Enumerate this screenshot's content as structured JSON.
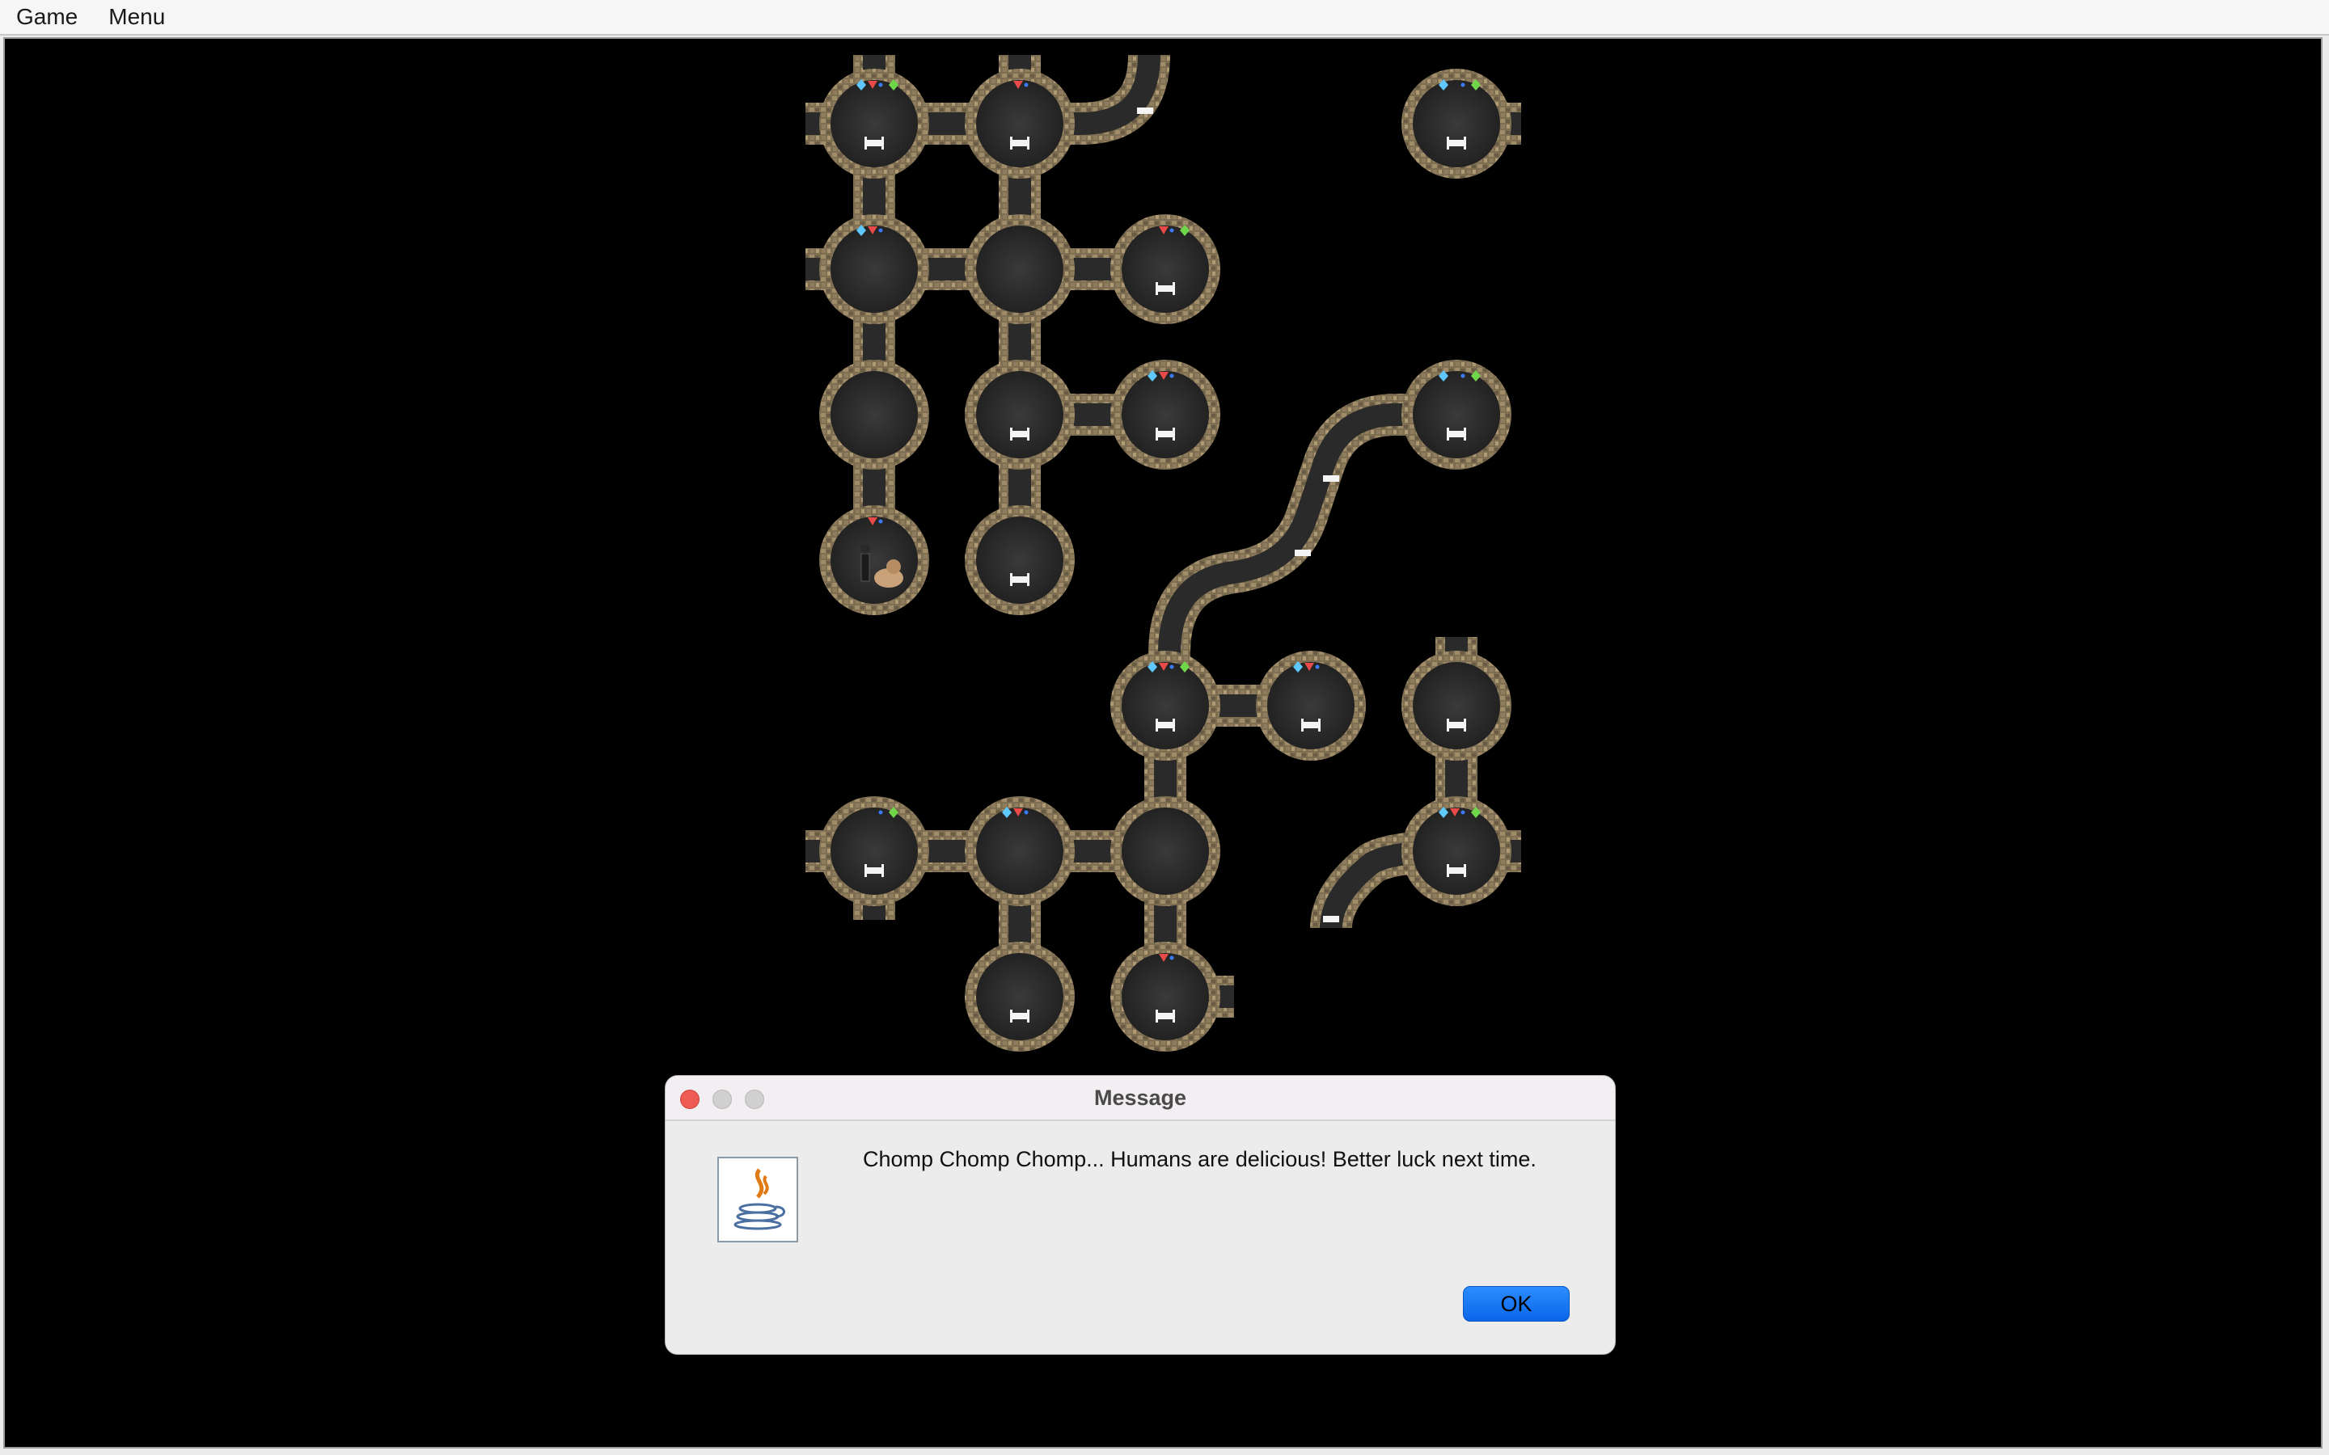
{
  "menubar": {
    "items": [
      "Game",
      "Menu"
    ]
  },
  "dialog": {
    "title": "Message",
    "message": "Chomp Chomp Chomp... Humans are delicious! Better luck next time.",
    "ok_label": "OK",
    "icon": "java-icon"
  },
  "colors": {
    "background": "#000000",
    "room_floor": "#2f2f2f",
    "stone_wall": "#8a7a5c",
    "dialog_bg": "#ececec",
    "ok_button": "#0a66e8",
    "close_button": "#ee5b55"
  }
}
